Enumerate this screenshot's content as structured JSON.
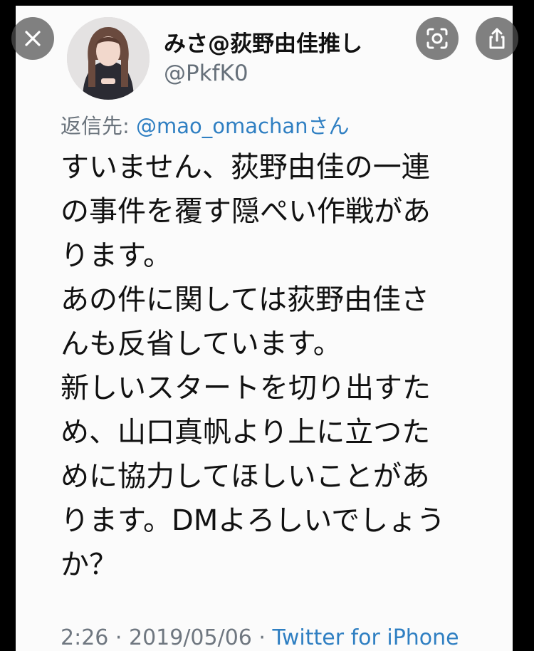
{
  "tweet": {
    "display_name": "みさ@荻野由佳推し",
    "handle": "@PkfK0",
    "reply_label": "返信先: ",
    "reply_mention": "@mao_omachanさん",
    "body_lines": [
      "すいません、荻野由佳の一連",
      "の事件を覆す隠ぺい作戦があ",
      "ります。",
      "あの件に関しては荻野由佳さ",
      "んも反省しています。",
      "新しいスタートを切り出すた",
      "め、山口真帆より上に立つた",
      "めに協力してほしいことがあ",
      "ります。DMよろしいでしょう",
      "か？"
    ],
    "timestamp": "2:26 · 2019/05/06 · ",
    "source": "Twitter for iPhone"
  },
  "overlay": {
    "close_icon": "close-icon",
    "lens_icon": "lens-icon",
    "share_icon": "share-icon"
  },
  "colors": {
    "link": "#2f7fc2",
    "secondary_text": "#6a737c",
    "background": "#000000",
    "card": "#fbfbfb"
  }
}
